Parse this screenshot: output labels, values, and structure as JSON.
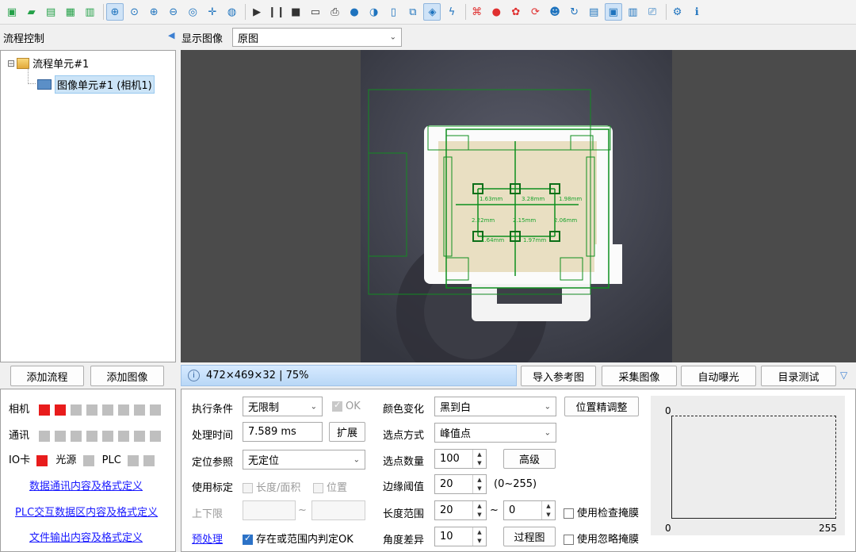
{
  "toolbar": {
    "icons": [
      "new-icon",
      "open-icon",
      "save-icon",
      "table-icon",
      "save-all-icon",
      "zoom-select-icon",
      "zoom-fit-icon",
      "zoom-in-icon",
      "zoom-out-icon",
      "view-icon",
      "crosshair-icon",
      "ring-icon",
      "run-icon",
      "pause-icon",
      "stop-icon",
      "crop-icon",
      "export-icon",
      "camera-icon",
      "color-icon",
      "mouse-icon",
      "roi-icon",
      "layers-icon",
      "flash-icon",
      "network-icon",
      "location-icon",
      "refresh-icon",
      "sync-icon",
      "user-icon",
      "rotate-icon",
      "window-icon",
      "panel-icon",
      "monitor-icon",
      "printer-icon",
      "settings-icon",
      "info-icon"
    ],
    "glyphs": [
      "▣",
      "▰",
      "▤",
      "▦",
      "▥",
      "⊕",
      "⊙",
      "⊕",
      "⊖",
      "◎",
      "✛",
      "◍",
      "▶",
      "❙❙",
      "■",
      "▭",
      "⎙",
      "●",
      "◑",
      "▯",
      "⧉",
      "◈",
      "ϟ",
      "⌘",
      "●",
      "✿",
      "⟳",
      "☻",
      "↻",
      "▤",
      "▣",
      "▥",
      "⎚",
      "⚙",
      "ℹ"
    ],
    "colors": {
      "accent": "#1e73be",
      "green": "#24a148",
      "red": "#e03030",
      "yellow": "#f2c230"
    }
  },
  "sidebar": {
    "title": "流程控制",
    "tree": {
      "root_toggle": "⊟",
      "root_label": "流程单元#1",
      "child_label": "图像单元#1 (相机1)"
    },
    "buttons": {
      "add_flow": "添加流程",
      "add_image": "添加图像"
    }
  },
  "display": {
    "label": "显示图像",
    "select_value": "原图"
  },
  "viewer": {
    "measurements": [
      "1.63mm",
      "3.28mm",
      "1.98mm",
      "2.22mm",
      "2.15mm",
      "2.06mm",
      "1.64mm",
      "1.97mm"
    ]
  },
  "status": {
    "info": "472×469×32 | 75%",
    "buttons": {
      "import_ref": "导入参考图",
      "capture": "采集图像",
      "auto_exposure": "自动曝光",
      "dir_test": "目录测试"
    }
  },
  "io_panel": {
    "camera_label": "相机",
    "comm_label": "通讯",
    "io_label": "IO卡",
    "light_label": "光源",
    "plc_label": "PLC",
    "links": [
      "数据通讯内容及格式定义",
      "PLC交互数据区内容及格式定义",
      "文件输出内容及格式定义"
    ]
  },
  "settings": {
    "exec_cond_label": "执行条件",
    "exec_cond_value": "无限制",
    "ok_label": "OK",
    "proc_time_label": "处理时间",
    "proc_time_value": "7.589 ms",
    "expand_button": "扩展",
    "locate_ref_label": "定位参照",
    "locate_ref_value": "无定位",
    "use_calib_label": "使用标定",
    "length_area_label": "长度/面积",
    "position_label": "位置",
    "limits_label": "上下限",
    "tilde": "~",
    "preprocess_link": "预处理",
    "judge_label": "存在或范围内判定OK"
  },
  "edge": {
    "color_change_label": "颜色变化",
    "color_change_value": "黑到白",
    "fine_tune_button": "位置精调整",
    "select_mode_label": "选点方式",
    "select_mode_value": "峰值点",
    "count_label": "选点数量",
    "count_value": "100",
    "advanced_button": "高级",
    "threshold_label": "边缘阈值",
    "threshold_value": "20",
    "threshold_range": "(0~255)",
    "length_label": "长度范围",
    "length_min": "20",
    "length_tilde": "~",
    "length_max": "0",
    "use_check_mask": "使用检查掩膜",
    "angle_label": "角度差异",
    "angle_value": "10",
    "process_button": "过程图",
    "use_ignore_mask": "使用忽略掩膜"
  },
  "histogram": {
    "y_top": "0",
    "x_min": "0",
    "x_max": "255"
  }
}
